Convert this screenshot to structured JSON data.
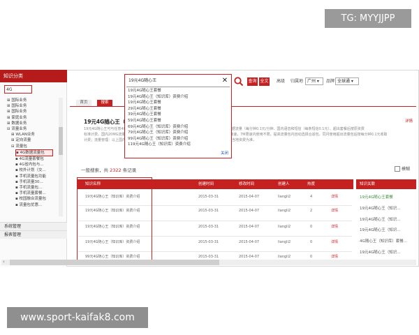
{
  "watermarks": {
    "top": "TG: MYYJJPP",
    "bottom": "www.sport-kaifak8.com"
  },
  "sidebar": {
    "header": "知识分类",
    "search_value": "4G",
    "tree": [
      "国际业务",
      "国际业务",
      "国际业务",
      "家庭业务",
      "数据业务",
      "流量业务",
      "WLAN业务",
      "定向流量",
      "流量包",
      "4G数据流量包",
      "4G流量套餐包",
      "4G省内包与...",
      "校外计划（交...",
      "手机流量包功能",
      "手机流量30...",
      "手机流量包...",
      "手机流量套餐...",
      "校园融合流量包",
      "流量包优惠..."
    ],
    "bottom_items": [
      "系统管理",
      "报表管理"
    ]
  },
  "search": {
    "value": "19元4G随心王",
    "clear": "✕",
    "btn_query": "查询",
    "btn_full": "全文"
  },
  "filters": {
    "scope_label": "高级",
    "city_label": "归属地",
    "city_value": "广州",
    "brand_label": "品牌",
    "brand_value": "全球通"
  },
  "dropdown": {
    "items": [
      "19元4G随心王套餐",
      "19元4G随心王（知识库）资费介绍",
      "19元4G随心王套餐",
      "29元4G随心王套餐",
      "39元4G随心王套餐",
      "59元4G随心王套餐",
      "69元4G随心王（知识库）资费介绍",
      "79元4G随心王（知识库）资费介绍",
      "99元4G随心王（知识库）资费介绍",
      "119元4G随心王（知识库）资费介绍"
    ],
    "close": "关闭"
  },
  "tabs": {
    "home": "首页",
    "search": "搜索"
  },
  "content": {
    "title": "19元4G随心王（",
    "text_line1": "19元4G随心王可与任意4G套餐搭配使用，在原有套餐包含的基础资费外提供每月19元，国内数据流量（每分钟0.1元/分钟、国内语音和短信（每条短信0.1元）、超出套餐后按原资费",
    "text_line2": "标准计费。国内20MG流量资费国内数据每月限额最高为25元，当月使用流量达到5折后，自动降速，7M限速内使用不限，提高流量包内自动选择合适包，同月使用超出流量包后按每分钟0.1元收取",
    "text_line3": "计费；流量管理：以上国内流量不包含国际及港澳台漫游流量，4G网络覆盖以实际为准，具体以当地资费为准，",
    "edit": "详情"
  },
  "results": {
    "prefix": "一般搜索，共",
    "count": "2322",
    "suffix": "条记录"
  },
  "table": {
    "headers": [
      "知识名称",
      "创建时间",
      "修改时间",
      "创建人",
      "热度"
    ],
    "rows": [
      {
        "name": "19元4G随心王（知识库）资费介绍",
        "created": "2015-03-31",
        "modified": "2015-04-07",
        "creator": "liangli2",
        "heat": "4",
        "op": "详情"
      },
      {
        "name": "19元4G随心王（知识库）资费介绍",
        "created": "2015-03-31",
        "modified": "2015-04-07",
        "creator": "liangli2",
        "heat": "2",
        "op": "详情"
      },
      {
        "name": "19元4G随心王（知识库）资费介绍",
        "created": "2015-03-31",
        "modified": "2015-04-07",
        "creator": "liangli2",
        "heat": "0",
        "op": "详情"
      },
      {
        "name": "19元4G随心王（知识库）资费介绍",
        "created": "2015-03-31",
        "modified": "2015-04-07",
        "creator": "liangli2",
        "heat": "0",
        "op": "详情"
      },
      {
        "name": "99元4G随心王（知识库）资费介绍",
        "created": "2015-03-31",
        "modified": "2015-04-07",
        "creator": "liangli2",
        "heat": "0",
        "op": "详情"
      }
    ]
  },
  "related": {
    "header": "知识关联",
    "checkbox_label": "模糊",
    "items": [
      "19元4G随心王套餐",
      "19元4G随心王（知识...",
      "19元4G随心王（知识...",
      "19元4G随心王（知识...",
      "4G随心王（知识库）套餐...",
      "19元4G随心王（知识...",
      "19元4G随心王（知识..."
    ]
  }
}
